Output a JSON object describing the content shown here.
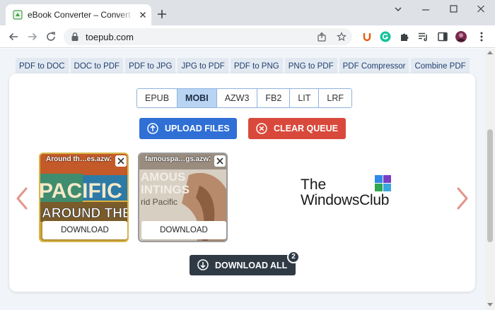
{
  "browser": {
    "tab_title": "eBook Converter – Convert PDF & EPUB",
    "url": "toepub.com",
    "new_tab_icon": "plus-icon",
    "window_controls": [
      "chevron-down-icon",
      "minimize-icon",
      "maximize-icon",
      "close-icon"
    ]
  },
  "tool_nav": [
    {
      "label": "PDF to DOC"
    },
    {
      "label": "DOC to PDF"
    },
    {
      "label": "PDF to JPG"
    },
    {
      "label": "JPG to PDF"
    },
    {
      "label": "PDF to PNG"
    },
    {
      "label": "PNG to PDF"
    },
    {
      "label": "PDF Compressor"
    },
    {
      "label": "Combine PDF"
    }
  ],
  "formats": {
    "items": [
      "EPUB",
      "MOBI",
      "AZW3",
      "FB2",
      "LIT",
      "LRF"
    ],
    "selected": "MOBI"
  },
  "actions": {
    "upload_label": "UPLOAD FILES",
    "clear_label": "CLEAR QUEUE",
    "download_all_label": "DOWNLOAD ALL",
    "download_count": "2"
  },
  "files": [
    {
      "name": "Around th…es.azw3",
      "download_label": "DOWNLOAD",
      "cover_text_1": "PACIFIC",
      "cover_text_2": "AROUND THE"
    },
    {
      "name": "famouspa…gs.azw3",
      "download_label": "DOWNLOAD",
      "cover_text_1": "AMOUS",
      "cover_text_2": "INTINGS",
      "cover_text_3": "rid Pacific"
    }
  ],
  "watermark": {
    "line1": "The",
    "line2": "WindowsClub"
  },
  "colors": {
    "upload_button": "#2f6fd6",
    "clear_button": "#d9493b",
    "download_all_button": "#2f3a45",
    "selected_format": "#b9d3f3",
    "carousel_arrow": "#e4948a"
  }
}
